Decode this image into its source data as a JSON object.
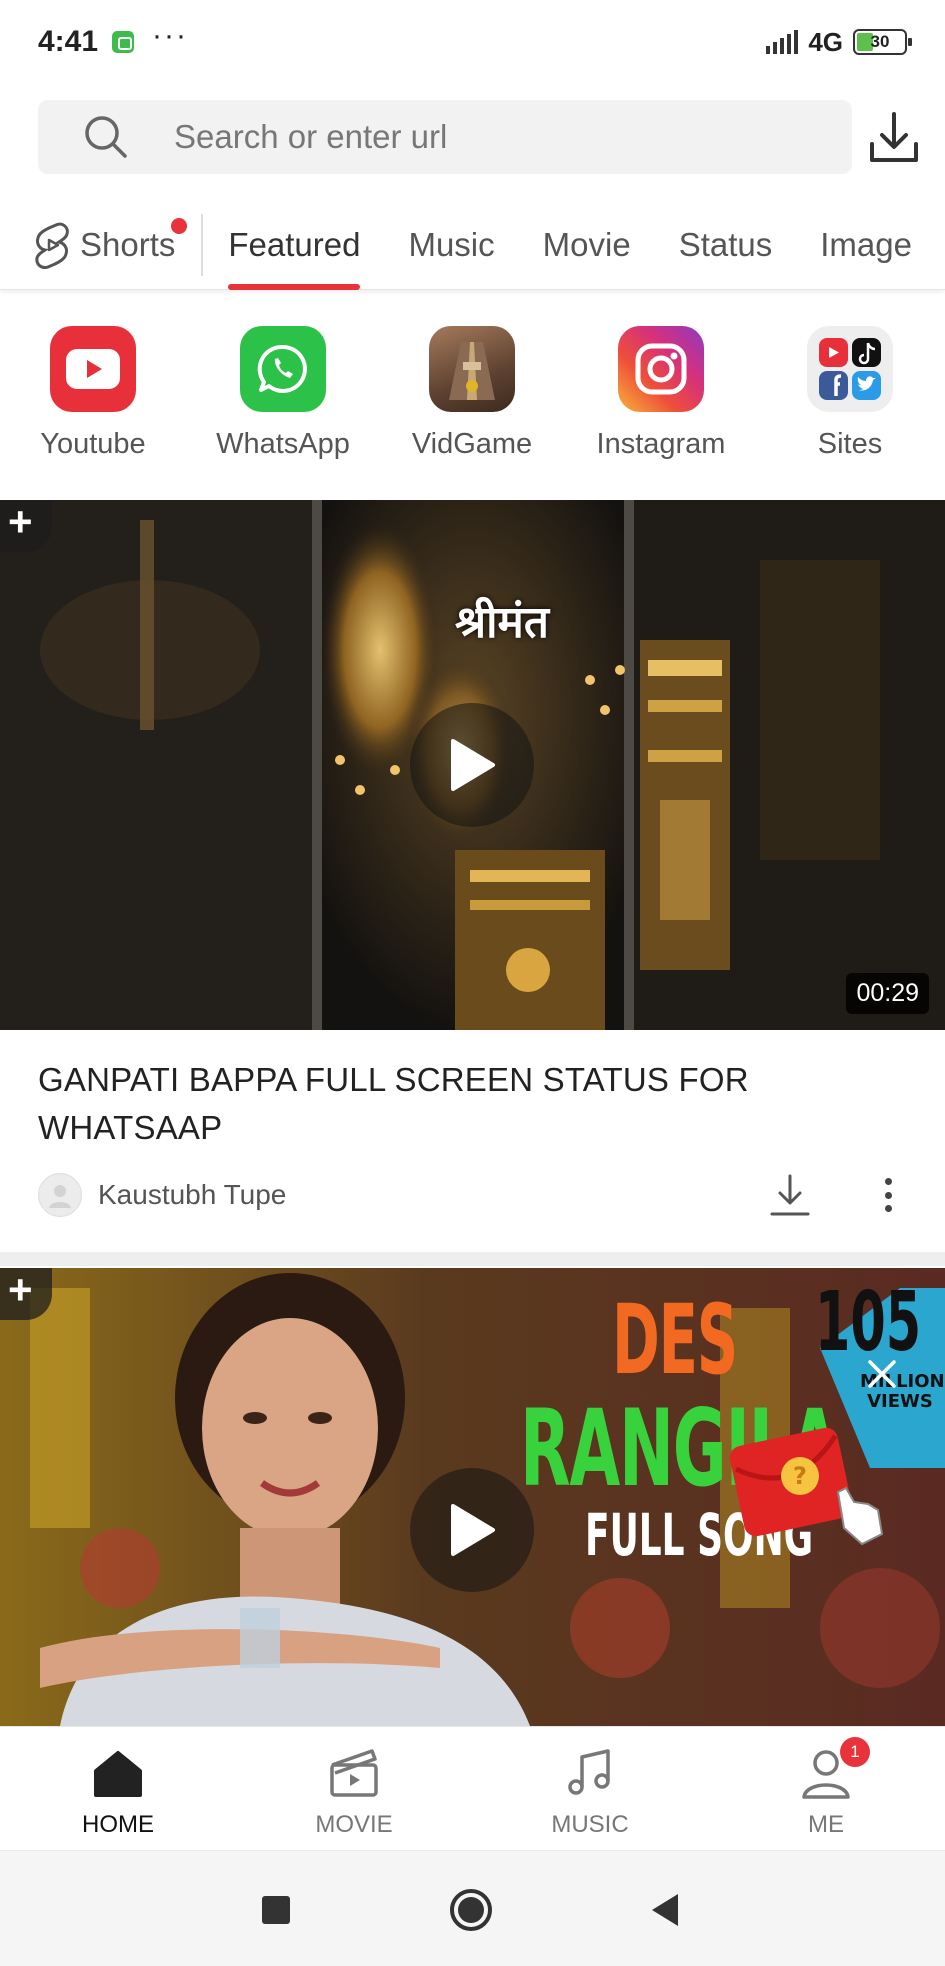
{
  "status_bar": {
    "time": "4:41",
    "dots": "···",
    "network": "4G",
    "battery": "30"
  },
  "search": {
    "placeholder": "Search or enter url"
  },
  "tabs": [
    {
      "label": "Shorts",
      "has_dot": true
    },
    {
      "label": "Featured",
      "active": true
    },
    {
      "label": "Music"
    },
    {
      "label": "Movie"
    },
    {
      "label": "Status"
    },
    {
      "label": "Image"
    }
  ],
  "quick_apps": [
    {
      "label": "Youtube",
      "icon": "youtube-icon",
      "color": "#e8303a"
    },
    {
      "label": "WhatsApp",
      "icon": "whatsapp-icon",
      "color": "#2cc24a"
    },
    {
      "label": "VidGame",
      "icon": "vidgame-icon",
      "color": "#7a5a48"
    },
    {
      "label": "Instagram",
      "icon": "instagram-icon",
      "color": "#d6307a"
    },
    {
      "label": "Sites",
      "icon": "sites-icon",
      "color": "#f0f0f0"
    }
  ],
  "videos": [
    {
      "title": "GANPATI BAPPA FULL SCREEN STATUS FOR WHATSAAP",
      "thumbnail_text": "श्रीमंत",
      "duration": "00:29",
      "channel": "Kaustubh Tupe"
    },
    {
      "thumbnail_lines": [
        "DES",
        "RANGILA",
        "FULL SONG"
      ],
      "badge_number": "105",
      "badge_text": "MILLION+ VIEWS"
    }
  ],
  "add_symbol": "+",
  "bottom_nav": [
    {
      "label": "HOME",
      "icon": "home-icon",
      "active": true
    },
    {
      "label": "MOVIE",
      "icon": "movie-icon"
    },
    {
      "label": "MUSIC",
      "icon": "music-icon"
    },
    {
      "label": "ME",
      "icon": "person-icon",
      "badge": "1"
    }
  ],
  "colors": {
    "accent": "#e8333a",
    "text_primary": "#222222",
    "text_secondary": "#555555"
  }
}
